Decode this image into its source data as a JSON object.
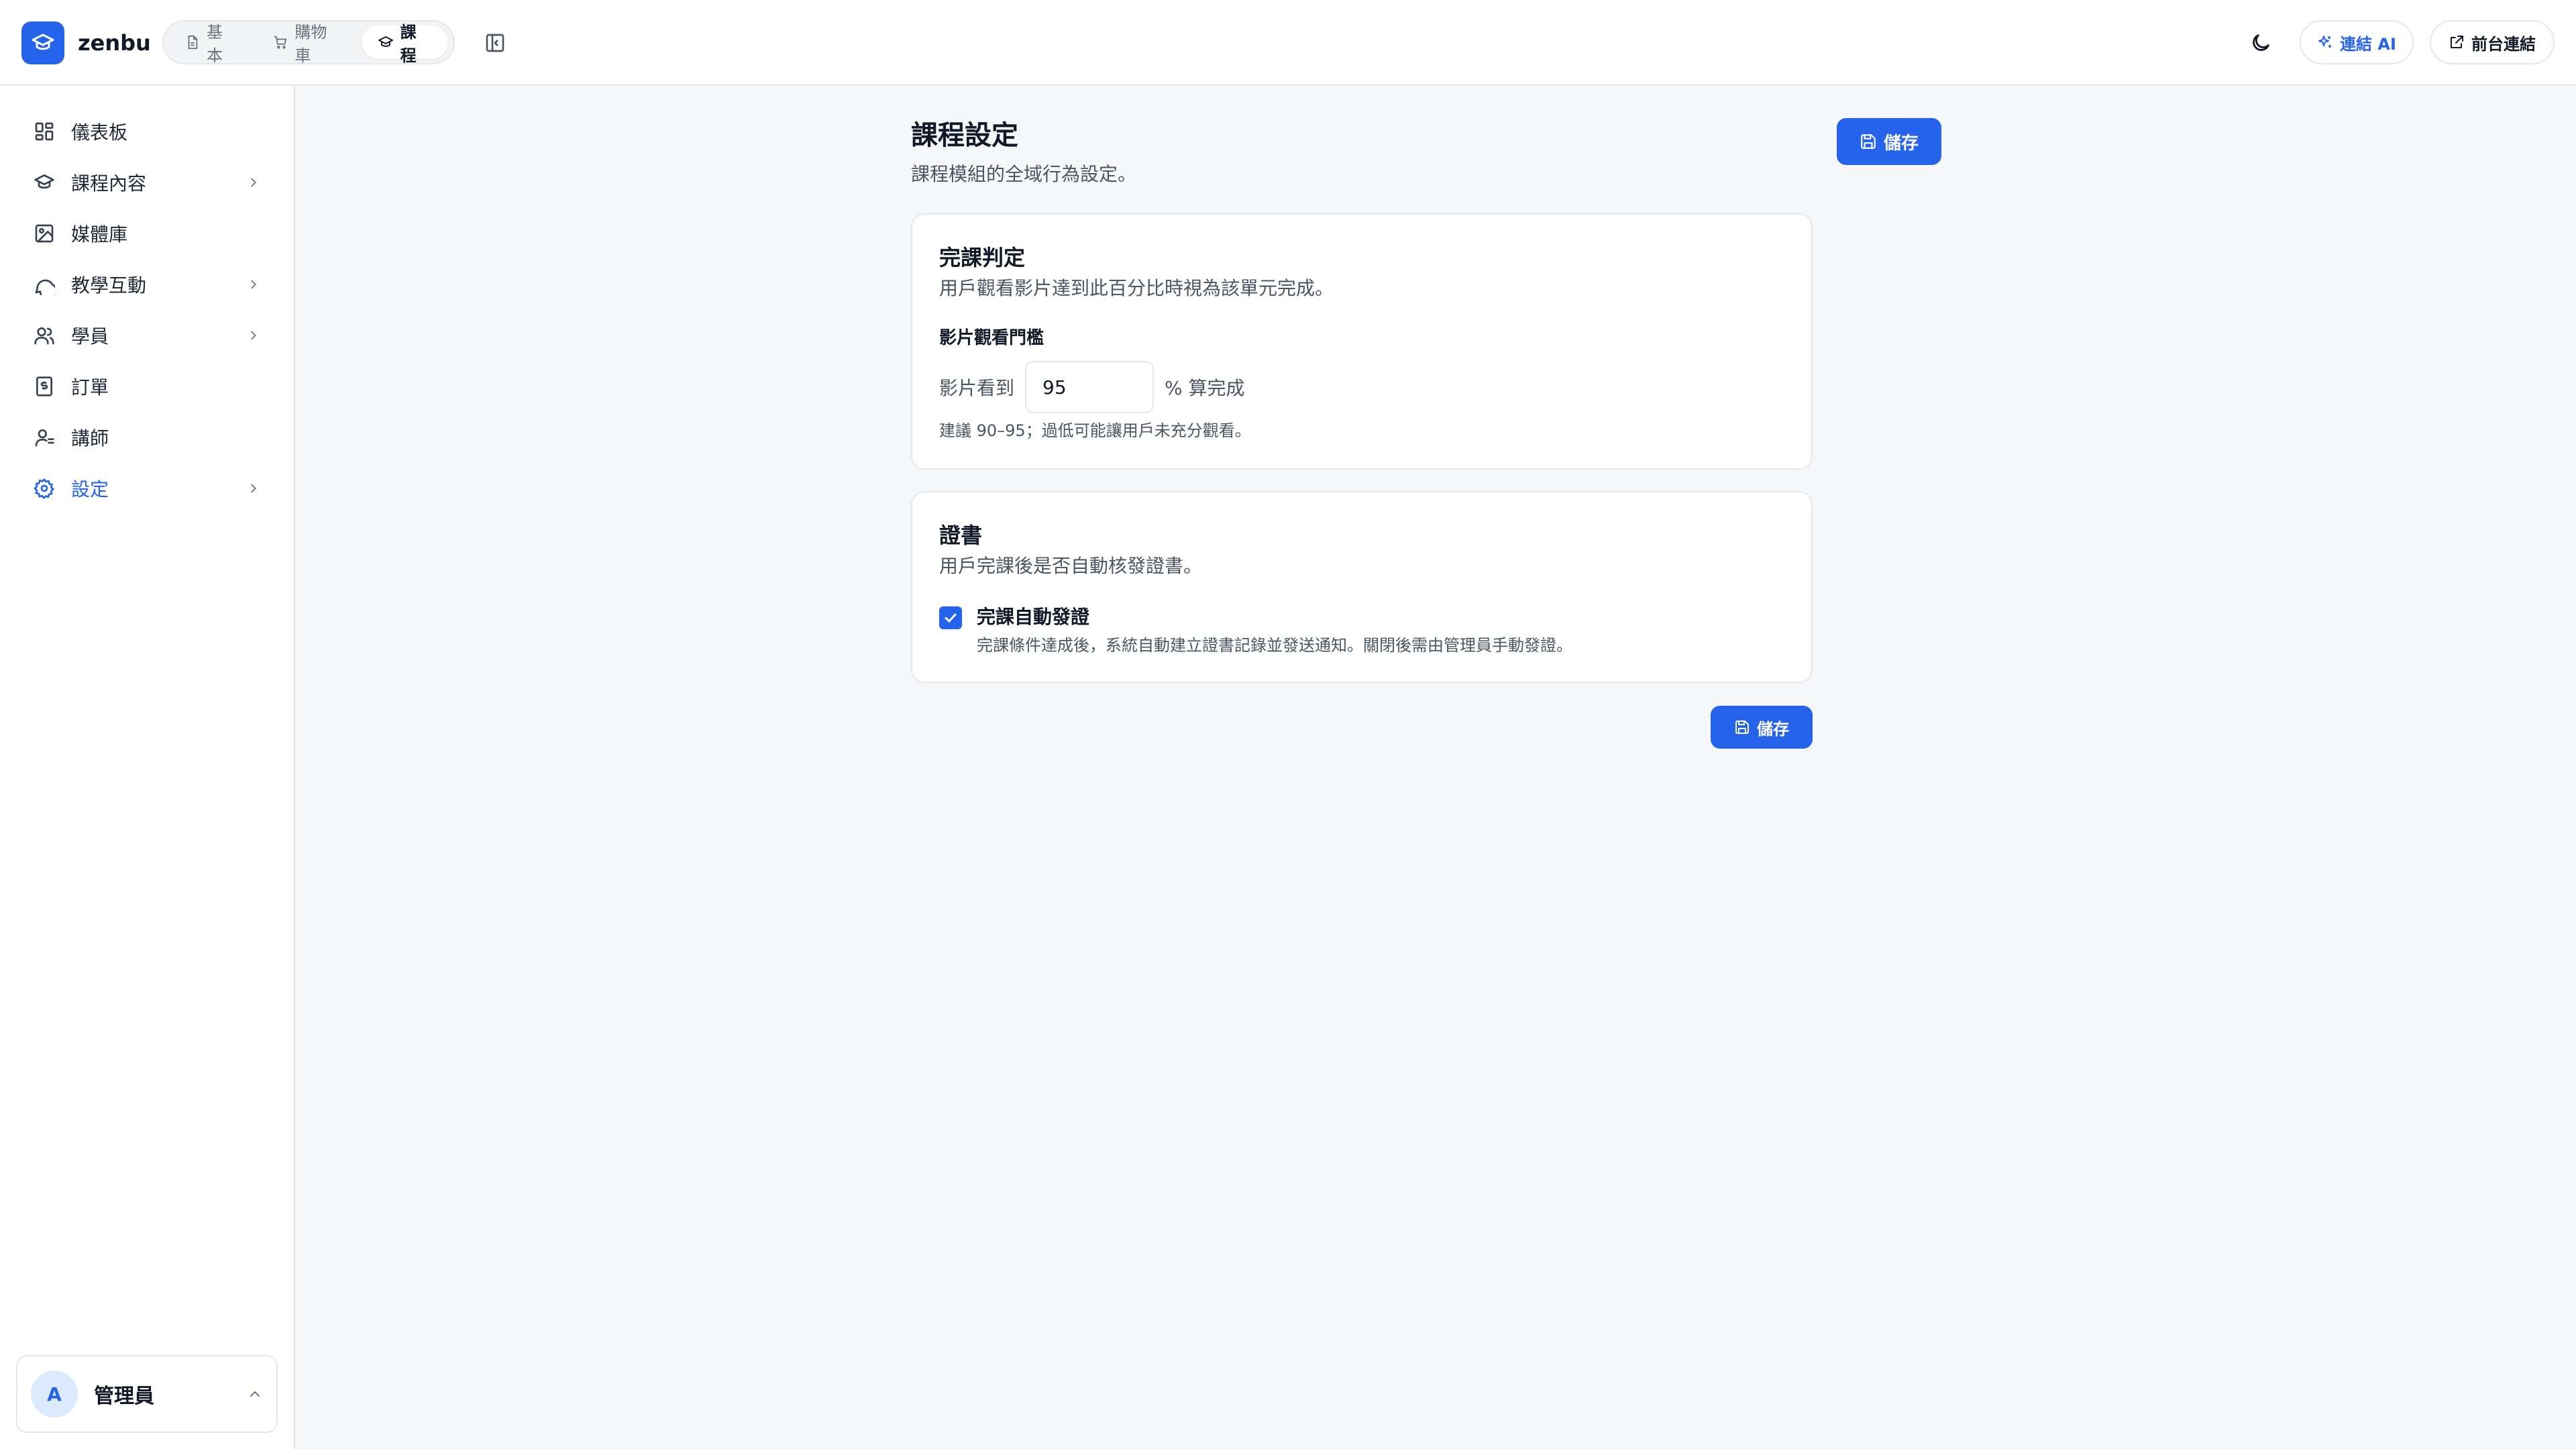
{
  "app": {
    "brand": "zenbu",
    "logo_icon": "graduation-cap-icon"
  },
  "header": {
    "mode_tabs": [
      {
        "label": "基本",
        "icon": "file-icon",
        "active": false
      },
      {
        "label": "購物車",
        "icon": "cart-icon",
        "active": false
      },
      {
        "label": "課程",
        "icon": "graduation-cap-icon",
        "active": true
      }
    ],
    "connect_ai_label": "連結 AI",
    "frontend_link_label": "前台連結"
  },
  "sidebar": {
    "items": [
      {
        "label": "儀表板",
        "icon": "dashboard-icon",
        "has_children": false,
        "active": false
      },
      {
        "label": "課程內容",
        "icon": "graduation-cap-icon",
        "has_children": true,
        "active": false
      },
      {
        "label": "媒體庫",
        "icon": "image-icon",
        "has_children": false,
        "active": false
      },
      {
        "label": "教學互動",
        "icon": "chat-icon",
        "has_children": true,
        "active": false
      },
      {
        "label": "學員",
        "icon": "users-icon",
        "has_children": true,
        "active": false
      },
      {
        "label": "訂單",
        "icon": "receipt-icon",
        "has_children": false,
        "active": false
      },
      {
        "label": "講師",
        "icon": "instructor-icon",
        "has_children": false,
        "active": false
      },
      {
        "label": "設定",
        "icon": "gear-icon",
        "has_children": true,
        "active": true
      }
    ],
    "user": {
      "avatar_initial": "A",
      "name": "管理員"
    }
  },
  "main": {
    "title": "課程設定",
    "subtitle": "課程模組的全域行為設定。",
    "save_label": "儲存",
    "completion": {
      "title": "完課判定",
      "description": "用戶觀看影片達到此百分比時視為該單元完成。",
      "field_label": "影片觀看門檻",
      "prefix": "影片看到",
      "value": "95",
      "suffix": "% 算完成",
      "hint": "建議 90–95；過低可能讓用戶未充分觀看。"
    },
    "certificate": {
      "title": "證書",
      "description": "用戶完課後是否自動核發證書。",
      "checkbox_label": "完課自動發證",
      "checked": true,
      "checkbox_description": "完課條件達成後，系統自動建立證書記錄並發送通知。關閉後需由管理員手動發證。"
    }
  },
  "colors": {
    "accent": "#2563eb",
    "accent_soft": "#dbeafe",
    "border": "#e5e7eb",
    "bg": "#f6f7f9"
  }
}
